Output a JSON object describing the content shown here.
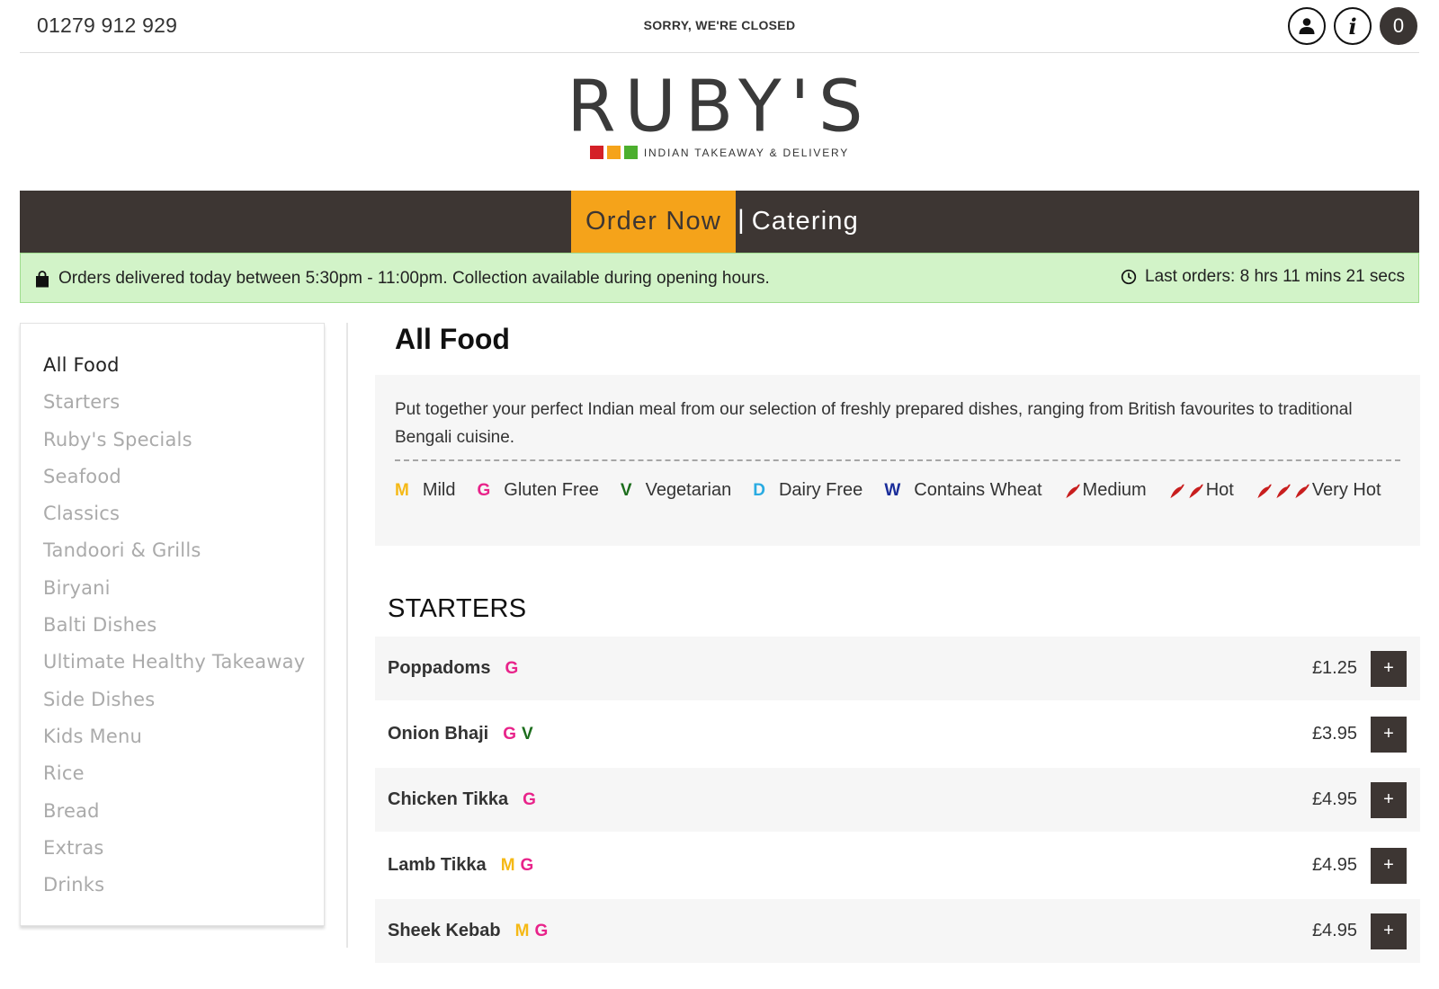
{
  "header": {
    "phone": "01279 912 929",
    "status": "SORRY, WE'RE CLOSED",
    "cart_count": "0"
  },
  "logo": {
    "wordmark": "RUBY'S",
    "tagline": "INDIAN TAKEAWAY & DELIVERY",
    "colors": [
      "#d42027",
      "#f5a31a",
      "#4caf2e"
    ]
  },
  "nav": {
    "order_now": "Order Now",
    "separator": "|",
    "catering": "Catering"
  },
  "notice": {
    "delivery": "Orders delivered today between 5:30pm - 11:00pm. Collection available during opening hours.",
    "last_orders": "Last orders: 8 hrs 11 mins 21 secs"
  },
  "sidebar": {
    "items": [
      "All Food",
      "Starters",
      "Ruby's Specials",
      "Seafood",
      "Classics",
      "Tandoori & Grills",
      "Biryani",
      "Balti Dishes",
      "Ultimate Healthy Takeaway",
      "Side Dishes",
      "Kids Menu",
      "Rice",
      "Bread",
      "Extras",
      "Drinks"
    ]
  },
  "main": {
    "title": "All Food",
    "intro": "Put together your perfect Indian meal from our selection of freshly prepared dishes, ranging from British favourites to traditional Bengali cuisine.",
    "legend": {
      "mild_key": "M",
      "mild": "Mild",
      "gf_key": "G",
      "gf": "Gluten Free",
      "veg_key": "V",
      "veg": "Vegetarian",
      "df_key": "D",
      "df": "Dairy Free",
      "wheat_key": "W",
      "wheat": "Contains Wheat",
      "medium": "Medium",
      "hot": "Hot",
      "very_hot": "Very Hot"
    },
    "section": "STARTERS",
    "add_label": "+",
    "items": [
      {
        "name": "Poppadoms",
        "m": "",
        "g": "G",
        "v": "",
        "price": "£1.25"
      },
      {
        "name": "Onion Bhaji",
        "m": "",
        "g": "G",
        "v": "V",
        "price": "£3.95"
      },
      {
        "name": "Chicken Tikka",
        "m": "",
        "g": "G",
        "v": "",
        "price": "£4.95"
      },
      {
        "name": "Lamb Tikka",
        "m": "M",
        "g": "G",
        "v": "",
        "price": "£4.95"
      },
      {
        "name": "Sheek Kebab",
        "m": "M",
        "g": "G",
        "v": "",
        "price": "£4.95"
      }
    ]
  },
  "colors": {
    "brand_dark": "#3d3633",
    "brand_orange": "#f5a31a",
    "notice_green": "#d2f3c8",
    "tag_mild": "#f5b916",
    "tag_gluten": "#e8238a",
    "tag_veg": "#1c6d1c",
    "tag_dairy": "#29abe2",
    "tag_wheat": "#1a2d9a",
    "chili": "#c81e1e"
  }
}
